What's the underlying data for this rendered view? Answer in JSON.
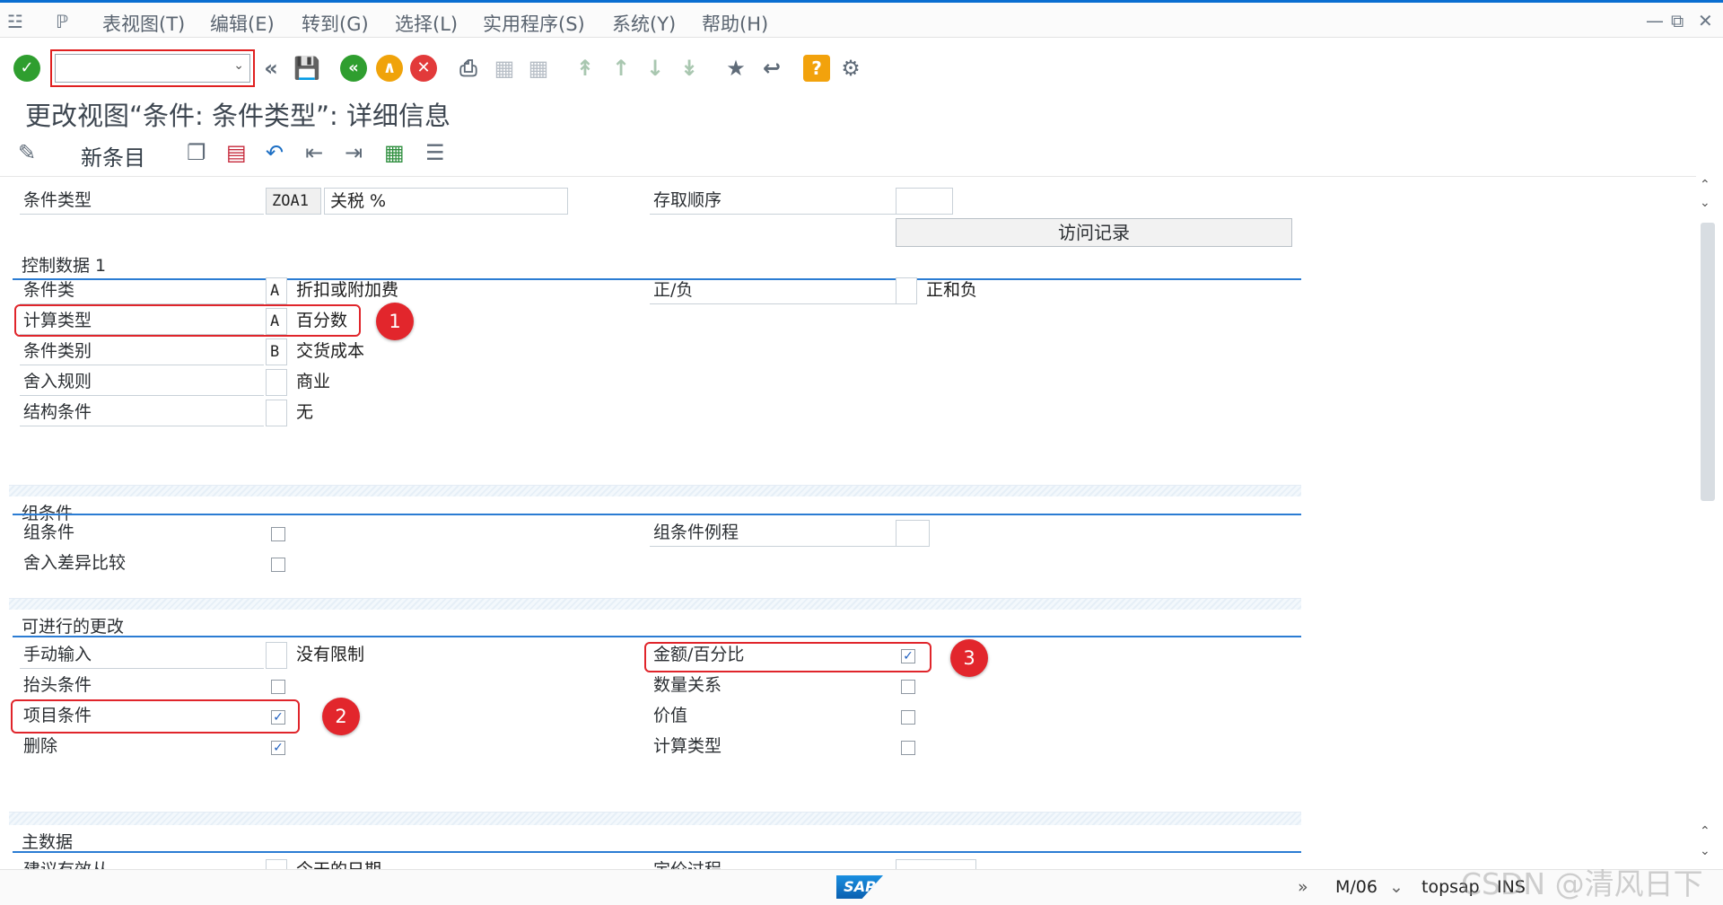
{
  "menubar": {
    "items": [
      "表视图(T)",
      "编辑(E)",
      "转到(G)",
      "选择(L)",
      "实用程序(S)",
      "系统(Y)",
      "帮助(H)"
    ]
  },
  "toolbar": {
    "command_field": {
      "value": "",
      "placeholder": ""
    },
    "icons": [
      "enter-icon",
      "back-double-icon",
      "save-icon",
      "back-icon",
      "exit-icon",
      "cancel-icon",
      "print-icon",
      "find-icon",
      "find-next-icon",
      "first-page-icon",
      "prev-page-icon",
      "next-page-icon",
      "last-page-icon",
      "create-session-icon",
      "shortcut-icon",
      "help-icon",
      "settings-icon"
    ],
    "help_glyph": "?"
  },
  "page_title": "更改视图“条件: 条件类型”: 详细信息",
  "app_toolbar": {
    "new_entry": "新条目"
  },
  "header": {
    "condition_type_label": "条件类型",
    "condition_type_code": "ZOA1",
    "condition_type_name": "关税 %",
    "access_sequence_label": "存取顺序",
    "access_sequence_value": "",
    "records_button": "访问记录"
  },
  "control_data_1": {
    "title": "控制数据 1",
    "rows": [
      {
        "label": "条件类",
        "code": "A",
        "text": "折扣或附加费"
      },
      {
        "label": "计算类型",
        "code": "A",
        "text": "百分数"
      },
      {
        "label": "条件类别",
        "code": "B",
        "text": "交货成本"
      },
      {
        "label": "舍入规则",
        "code": "",
        "text": "商业"
      },
      {
        "label": "结构条件",
        "code": "",
        "text": "无"
      }
    ],
    "plus_minus_label": "正/负",
    "plus_minus_code": "",
    "plus_minus_text": "正和负"
  },
  "group_condition": {
    "title": "组条件",
    "group_condition_label": "组条件",
    "group_condition_checked": false,
    "rounding_diff_label": "舍入差异比较",
    "rounding_diff_checked": false,
    "routine_label": "组条件例程",
    "routine_value": ""
  },
  "changes": {
    "title": "可进行的更改",
    "manual_entry_label": "手动输入",
    "manual_entry_code": "",
    "manual_entry_text": "没有限制",
    "left": [
      {
        "label": "抬头条件",
        "checked": false
      },
      {
        "label": "项目条件",
        "checked": true
      },
      {
        "label": "删除",
        "checked": true
      }
    ],
    "right": [
      {
        "label": "金额/百分比",
        "checked": true
      },
      {
        "label": "数量关系",
        "checked": false
      },
      {
        "label": "价值",
        "checked": false
      },
      {
        "label": "计算类型",
        "checked": false
      }
    ]
  },
  "master_data": {
    "title": "主数据",
    "cut_label_left": "建议有效从",
    "cut_text_left": "今天的日期",
    "cut_label_right": "定价过程"
  },
  "annotations": [
    "1",
    "2",
    "3"
  ],
  "status": {
    "session": "M/06",
    "server": "topsap",
    "mode": "INS",
    "logo": "SAP",
    "watermark": "CSDN @清风日下"
  },
  "check_glyph": "✓"
}
